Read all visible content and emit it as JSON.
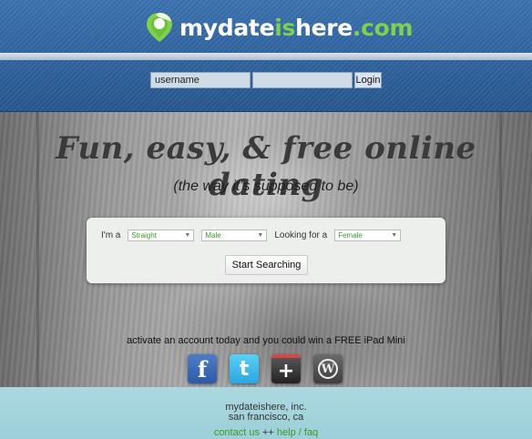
{
  "header": {
    "logo_part1": "mydate",
    "logo_part2": "is",
    "logo_part3": "here",
    "logo_part4": ".com",
    "login": {
      "username_value": "username",
      "password_value": "",
      "login_label": "Login"
    }
  },
  "hero": {
    "headline": "Fun, easy, & free online dating",
    "subhead": "(the way it's supposed to be)",
    "search": {
      "im_a_label": "I'm a",
      "orientation_value": "Straight",
      "gender_value": "Male",
      "looking_for_label": "Looking for a",
      "looking_value": "Female",
      "button_label": "Start Searching"
    },
    "promo": "activate an account today and you could win a FREE iPad Mini",
    "socials": [
      {
        "name": "facebook-icon",
        "glyph": "f"
      },
      {
        "name": "twitter-icon",
        "glyph": "t"
      },
      {
        "name": "google-plus-icon",
        "glyph": "+"
      },
      {
        "name": "wordpress-icon",
        "glyph": "W"
      }
    ]
  },
  "footer": {
    "company": "mydateishere, inc.",
    "location": "san francisco, ca",
    "link_contact": "contact us",
    "sep": " ++ ",
    "link_help": "help / faq"
  },
  "colors": {
    "header_blue": "#2f64a0",
    "brand_green": "#7fd14b",
    "footer_teal": "#abd8df",
    "link_green": "#3b9a2c"
  }
}
